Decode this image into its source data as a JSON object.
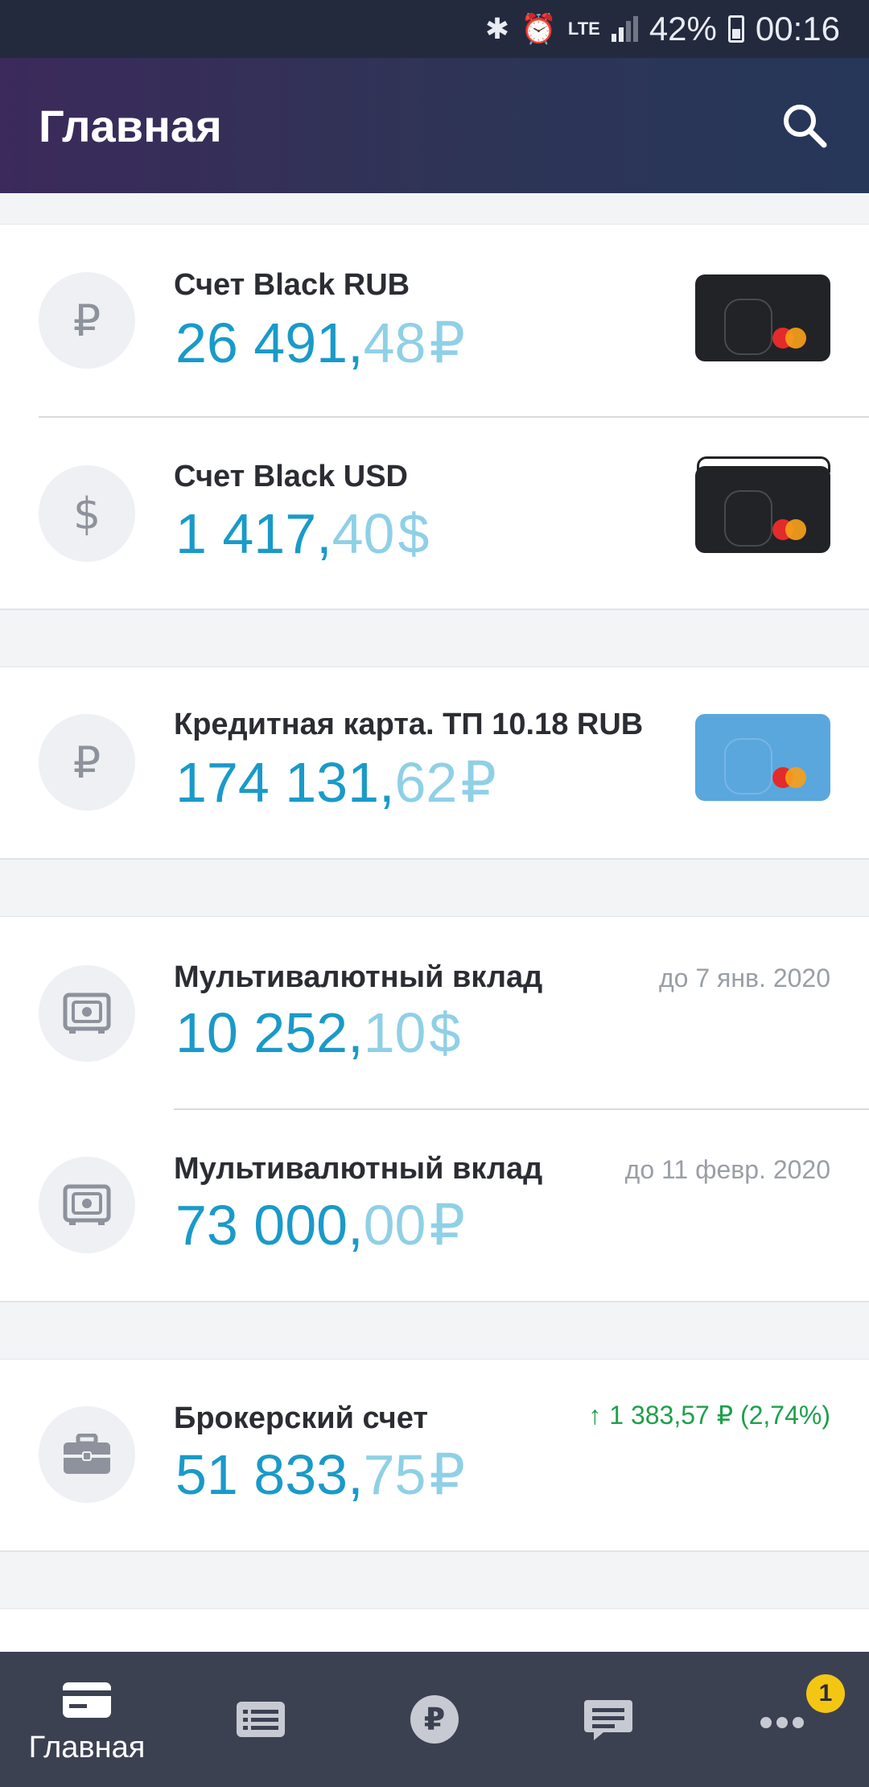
{
  "status_bar": {
    "network": "LTE",
    "battery": "42%",
    "time": "00:16"
  },
  "header": {
    "title": "Главная"
  },
  "accounts": [
    {
      "name": "Счет Black RUB",
      "whole": "26 491,",
      "cents": "48",
      "currency": "₽",
      "icon": "ruble-icon"
    },
    {
      "name": "Счет Black USD",
      "whole": "1 417,",
      "cents": "40",
      "currency": "$",
      "icon": "dollar-icon"
    }
  ],
  "credit": [
    {
      "name": "Кредитная карта. ТП 10.18 RUB",
      "whole": "174 131,",
      "cents": "62",
      "currency": "₽",
      "icon": "ruble-icon"
    }
  ],
  "deposits": [
    {
      "name": "Мультивалютный вклад",
      "whole": "10 252,",
      "cents": "10",
      "currency": "$",
      "until": "до 7 янв. 2020",
      "icon": "safe-icon"
    },
    {
      "name": "Мультивалютный вклад",
      "whole": "73 000,",
      "cents": "00",
      "currency": "₽",
      "until": "до 11 февр. 2020",
      "icon": "safe-icon"
    }
  ],
  "broker": [
    {
      "name": "Брокерский счет",
      "whole": "51 833,",
      "cents": "75",
      "currency": "₽",
      "gain": "1 383,57 ₽ (2,74%)",
      "icon": "briefcase-icon"
    }
  ],
  "bottom_nav": {
    "home_label": "Главная",
    "badge_count": "1"
  },
  "colors": {
    "amount": "#1a9ac8",
    "amount_light": "#8fd0e6",
    "gain": "#1ea04a",
    "badge": "#f4c614"
  }
}
